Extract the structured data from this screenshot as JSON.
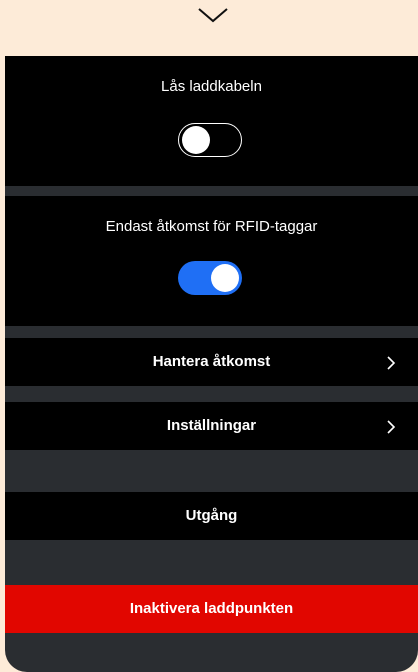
{
  "header": {
    "collapse_icon": "chevron-down-icon"
  },
  "settings": {
    "lock_cable": {
      "label": "Lås laddkabeln",
      "enabled": false
    },
    "rfid_only": {
      "label": "Endast åtkomst för RFID-taggar",
      "enabled": true
    }
  },
  "menu": {
    "manage_access": "Hantera åtkomst",
    "settings": "Inställningar",
    "exit": "Utgång",
    "chevron_icon": "chevron-right-icon"
  },
  "actions": {
    "deactivate": "Inaktivera laddpunkten"
  },
  "colors": {
    "background": "#fdebd8",
    "panel": "#2a2d31",
    "section": "#000000",
    "toggle_on": "#1f6ff5",
    "danger": "#e10600"
  }
}
